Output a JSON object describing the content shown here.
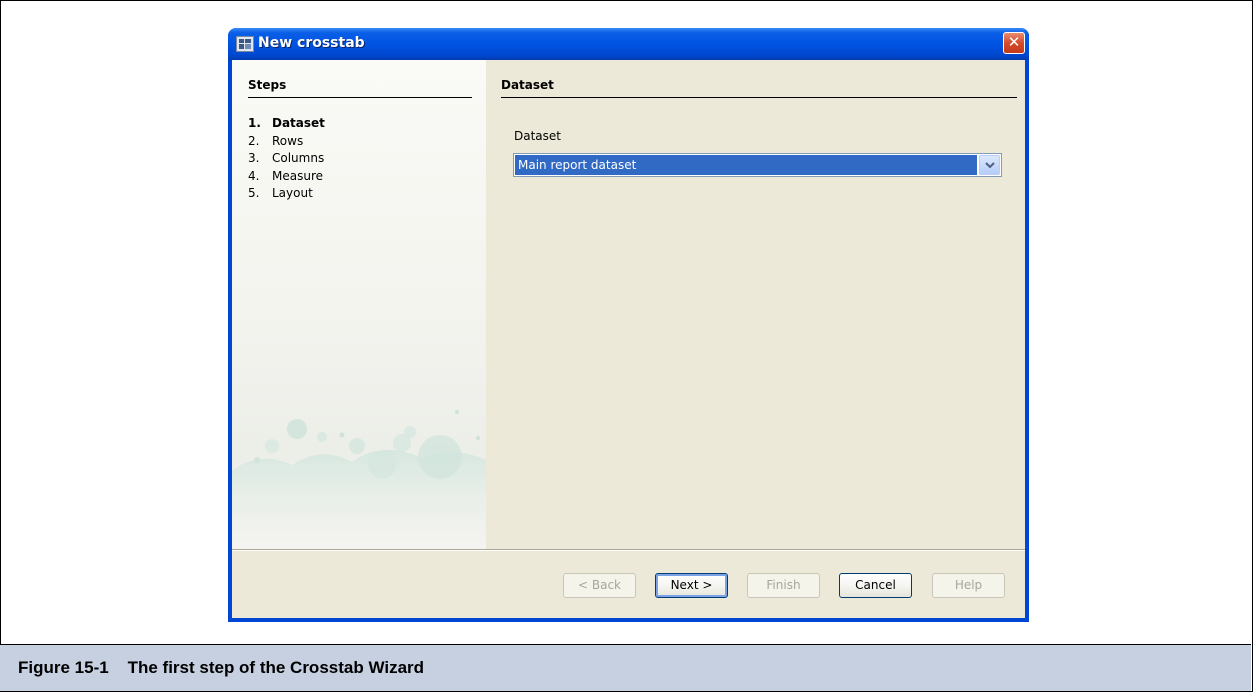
{
  "window": {
    "title": "New crosstab",
    "close_glyph": "✕"
  },
  "steps": {
    "title": "Steps",
    "items": [
      {
        "num": "1.",
        "label": "Dataset",
        "active": true
      },
      {
        "num": "2.",
        "label": "Rows",
        "active": false
      },
      {
        "num": "3.",
        "label": "Columns",
        "active": false
      },
      {
        "num": "4.",
        "label": "Measure",
        "active": false
      },
      {
        "num": "5.",
        "label": "Layout",
        "active": false
      }
    ]
  },
  "content": {
    "title": "Dataset",
    "field_label": "Dataset",
    "dataset_selected": "Main report dataset"
  },
  "buttons": {
    "back": "< Back",
    "next": "Next >",
    "finish": "Finish",
    "cancel": "Cancel",
    "help": "Help"
  },
  "figure": {
    "caption": "Figure 15-1    The first step of the Crosstab Wizard"
  },
  "colors": {
    "titlebar": "#0054e3",
    "selection": "#316ac5",
    "dialog_bg": "#ece9d8",
    "caption_bar": "#c6d0e0"
  }
}
